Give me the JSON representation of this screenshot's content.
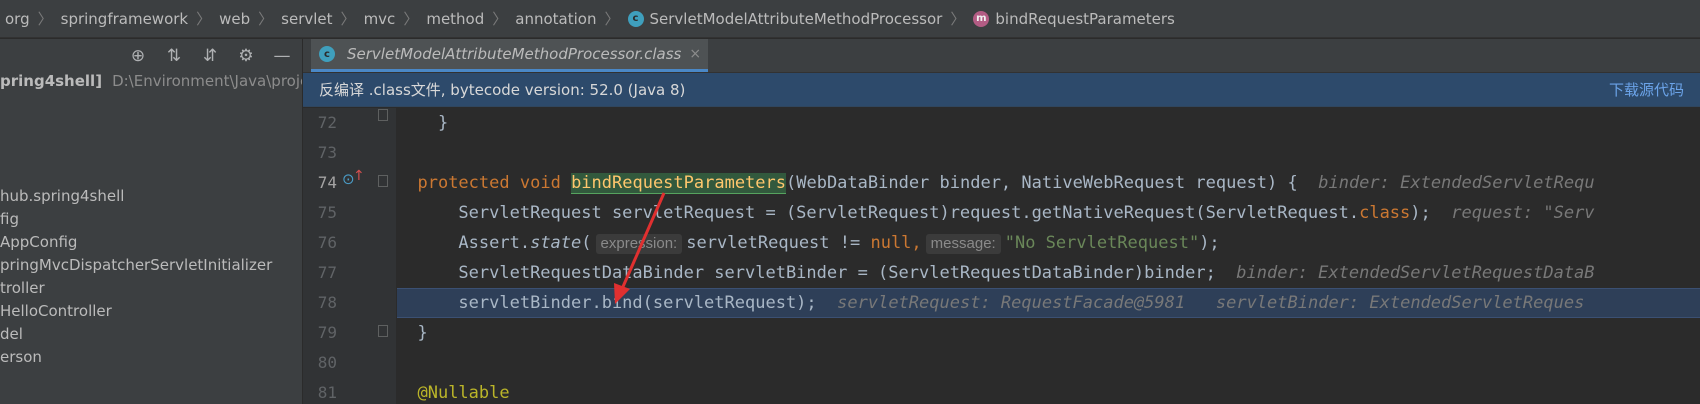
{
  "breadcrumb": {
    "items": [
      "org",
      "springframework",
      "web",
      "servlet",
      "mvc",
      "method",
      "annotation"
    ],
    "class_name": "ServletModelAttributeMethodProcessor",
    "method_name": "bindRequestParameters",
    "class_icon": "c",
    "method_icon": "m"
  },
  "project": {
    "root_name": "pring4shell]",
    "root_path": "D:\\Environment\\Java\\project\\s",
    "items": [
      "hub.spring4shell",
      "fig",
      "AppConfig",
      "pringMvcDispatcherServletInitializer",
      "troller",
      "HelloController",
      "del",
      "erson"
    ]
  },
  "tab": {
    "label": "ServletModelAttributeMethodProcessor.class",
    "icon": "c",
    "close": "×"
  },
  "banner": {
    "text": "反编译 .class文件, bytecode version: 52.0 (Java 8)",
    "link": "下载源代码"
  },
  "line_numbers": [
    "72",
    "73",
    "74",
    "75",
    "76",
    "77",
    "78",
    "79",
    "80",
    "81"
  ],
  "code": {
    "l72": "    }",
    "l74_kw1": "protected",
    "l74_kw2": "void",
    "l74_method": "bindRequestParameters",
    "l74_rest": "(WebDataBinder binder, NativeWebRequest request) {",
    "l74_hint": "binder: ExtendedServletRequ",
    "l75_a": "ServletRequest servletRequest = (ServletRequest)request.getNativeRequest(ServletRequest.",
    "l75_kw": "class",
    "l75_b": ");",
    "l75_hint": "request: \"Serv",
    "l76_a": "Assert.",
    "l76_state": "state",
    "l76_b": "(",
    "l76_p1": "expression:",
    "l76_c": "servletRequest != ",
    "l76_null": "null",
    "l76_d": ",",
    "l76_p2": "message:",
    "l76_str": "\"No ServletRequest\"",
    "l76_e": ");",
    "l77": "ServletRequestDataBinder servletBinder = (ServletRequestDataBinder)binder;",
    "l77_hint": "binder: ExtendedServletRequestDataB",
    "l78": "servletBinder.bind(servletRequest);",
    "l78_hint1": "servletRequest: RequestFacade@5981",
    "l78_hint2": "servletBinder: ExtendedServletReques",
    "l79": "}",
    "l81": "@Nullable"
  },
  "colors": {
    "keyword": "#cc7832",
    "method_highlight": "#32593d",
    "string": "#6a8759",
    "current_line": "#2e3f58",
    "annotation": "#bbb529",
    "arrow": "#e03030"
  }
}
